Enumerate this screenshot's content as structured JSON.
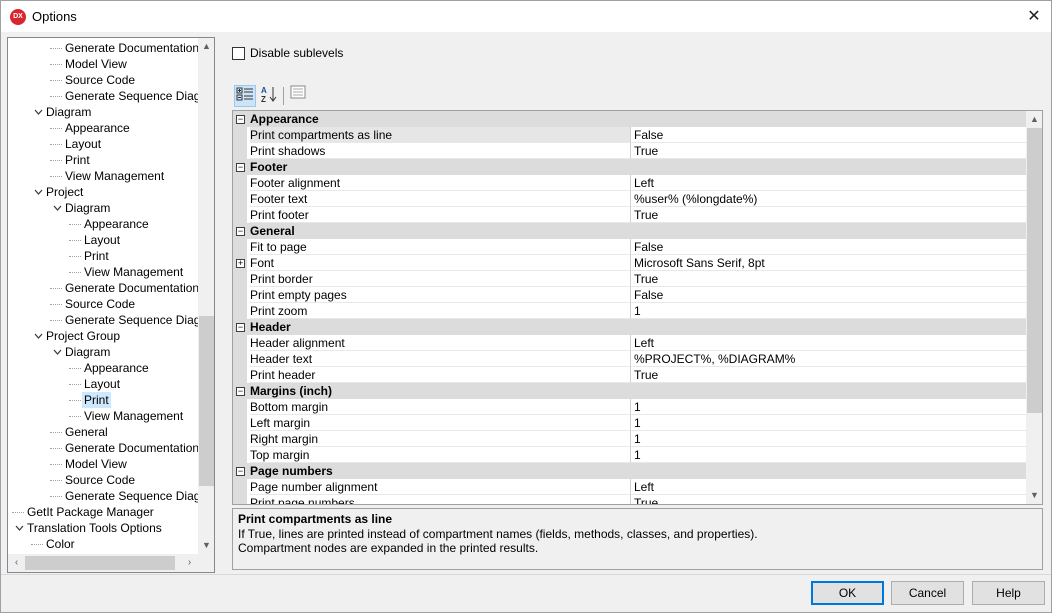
{
  "window": {
    "title": "Options",
    "logo_text": "DX",
    "close_glyph": "✕"
  },
  "tree": {
    "rows": [
      {
        "label": "Generate Documentation",
        "depth": 2,
        "expander": ""
      },
      {
        "label": "Model View",
        "depth": 2,
        "expander": ""
      },
      {
        "label": "Source Code",
        "depth": 2,
        "expander": ""
      },
      {
        "label": "Generate Sequence Diagram",
        "depth": 2,
        "expander": ""
      },
      {
        "label": "Diagram",
        "depth": 1,
        "expander": "v"
      },
      {
        "label": "Appearance",
        "depth": 2,
        "expander": ""
      },
      {
        "label": "Layout",
        "depth": 2,
        "expander": ""
      },
      {
        "label": "Print",
        "depth": 2,
        "expander": ""
      },
      {
        "label": "View Management",
        "depth": 2,
        "expander": ""
      },
      {
        "label": "Project",
        "depth": 1,
        "expander": "v"
      },
      {
        "label": "Diagram",
        "depth": 2,
        "expander": "v"
      },
      {
        "label": "Appearance",
        "depth": 3,
        "expander": ""
      },
      {
        "label": "Layout",
        "depth": 3,
        "expander": ""
      },
      {
        "label": "Print",
        "depth": 3,
        "expander": ""
      },
      {
        "label": "View Management",
        "depth": 3,
        "expander": ""
      },
      {
        "label": "Generate Documentation",
        "depth": 2,
        "expander": ""
      },
      {
        "label": "Source Code",
        "depth": 2,
        "expander": ""
      },
      {
        "label": "Generate Sequence Diagram",
        "depth": 2,
        "expander": ""
      },
      {
        "label": "Project Group",
        "depth": 1,
        "expander": "v"
      },
      {
        "label": "Diagram",
        "depth": 2,
        "expander": "v"
      },
      {
        "label": "Appearance",
        "depth": 3,
        "expander": ""
      },
      {
        "label": "Layout",
        "depth": 3,
        "expander": ""
      },
      {
        "label": "Print",
        "depth": 3,
        "expander": "",
        "selected": true
      },
      {
        "label": "View Management",
        "depth": 3,
        "expander": ""
      },
      {
        "label": "General",
        "depth": 2,
        "expander": ""
      },
      {
        "label": "Generate Documentation",
        "depth": 2,
        "expander": ""
      },
      {
        "label": "Model View",
        "depth": 2,
        "expander": ""
      },
      {
        "label": "Source Code",
        "depth": 2,
        "expander": ""
      },
      {
        "label": "Generate Sequence Diagram",
        "depth": 2,
        "expander": ""
      },
      {
        "label": "GetIt Package Manager",
        "depth": 0,
        "expander": ""
      },
      {
        "label": "Translation Tools Options",
        "depth": 0,
        "expander": "v"
      },
      {
        "label": "Color",
        "depth": 1,
        "expander": ""
      }
    ]
  },
  "options": {
    "disable_sublevels_label": "Disable sublevels",
    "disable_sublevels_checked": false
  },
  "toolbar": {
    "categorized_icon": "categorized-icon",
    "alphabetical_icon": "sort-az-icon",
    "property_pages_icon": "property-pages-icon"
  },
  "grid": {
    "rows": [
      {
        "type": "cat",
        "name": "Appearance",
        "toggle": "−"
      },
      {
        "type": "prop",
        "name": "Print compartments as line",
        "value": "False",
        "selected": true
      },
      {
        "type": "prop",
        "name": "Print shadows",
        "value": "True"
      },
      {
        "type": "cat",
        "name": "Footer",
        "toggle": "−"
      },
      {
        "type": "prop",
        "name": "Footer alignment",
        "value": "Left"
      },
      {
        "type": "prop",
        "name": "Footer text",
        "value": "%user% (%longdate%)"
      },
      {
        "type": "prop",
        "name": "Print footer",
        "value": "True"
      },
      {
        "type": "cat",
        "name": "General",
        "toggle": "−"
      },
      {
        "type": "prop",
        "name": "Fit to page",
        "value": "False"
      },
      {
        "type": "prop",
        "name": "Font",
        "value": "Microsoft Sans Serif, 8pt",
        "toggle": "+"
      },
      {
        "type": "prop",
        "name": "Print border",
        "value": "True"
      },
      {
        "type": "prop",
        "name": "Print empty pages",
        "value": "False"
      },
      {
        "type": "prop",
        "name": "Print zoom",
        "value": "1"
      },
      {
        "type": "cat",
        "name": "Header",
        "toggle": "−"
      },
      {
        "type": "prop",
        "name": "Header alignment",
        "value": "Left"
      },
      {
        "type": "prop",
        "name": "Header text",
        "value": "%PROJECT%, %DIAGRAM%"
      },
      {
        "type": "prop",
        "name": "Print header",
        "value": "True"
      },
      {
        "type": "cat",
        "name": "Margins (inch)",
        "toggle": "−"
      },
      {
        "type": "prop",
        "name": "Bottom margin",
        "value": "1"
      },
      {
        "type": "prop",
        "name": "Left margin",
        "value": "1"
      },
      {
        "type": "prop",
        "name": "Right margin",
        "value": "1"
      },
      {
        "type": "prop",
        "name": "Top margin",
        "value": "1"
      },
      {
        "type": "cat",
        "name": "Page numbers",
        "toggle": "−"
      },
      {
        "type": "prop",
        "name": "Page number alignment",
        "value": "Left"
      },
      {
        "type": "prop",
        "name": "Print page numbers",
        "value": "True"
      }
    ]
  },
  "description": {
    "title": "Print compartments as line",
    "line1": "If True, lines are printed instead of compartment names (fields, methods, classes, and properties).",
    "line2": "Compartment nodes are expanded in the printed results."
  },
  "buttons": {
    "ok": "OK",
    "cancel": "Cancel",
    "help": "Help"
  }
}
